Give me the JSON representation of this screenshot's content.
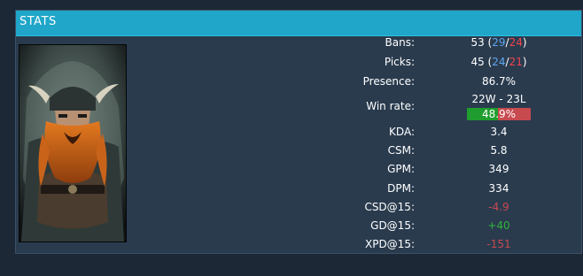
{
  "panel": {
    "title": "STATS"
  },
  "stats": {
    "bans": {
      "label": "Bans:",
      "total": "53",
      "open": " (",
      "blue": "29",
      "sep": "/",
      "red": "24",
      "close": ")"
    },
    "picks": {
      "label": "Picks:",
      "total": "45",
      "open": " (",
      "blue": "24",
      "sep": "/",
      "red": "21",
      "close": ")"
    },
    "presence": {
      "label": "Presence:",
      "value": "86.7%"
    },
    "win_rate": {
      "label": "Win rate:",
      "record": "22W - 23L",
      "percent": "48.9%",
      "fraction": 0.489
    },
    "kda": {
      "label": "KDA:",
      "value": "3.4"
    },
    "csm": {
      "label": "CSM:",
      "value": "5.8"
    },
    "gpm": {
      "label": "GPM:",
      "value": "349"
    },
    "dpm": {
      "label": "DPM:",
      "value": "334"
    },
    "csd15": {
      "label": "CSD@15:",
      "value": "-4.9"
    },
    "gd15": {
      "label": "GD@15:",
      "value": "+40"
    },
    "xpd15": {
      "label": "XPD@15:",
      "value": "-151"
    }
  },
  "colors": {
    "header": "#1fa6c9",
    "panel": "#2a3b4e",
    "blue_side": "#5fa6ee",
    "red_side": "#f2444d",
    "win": "#1f9d2e",
    "loss": "#c74a4f"
  }
}
